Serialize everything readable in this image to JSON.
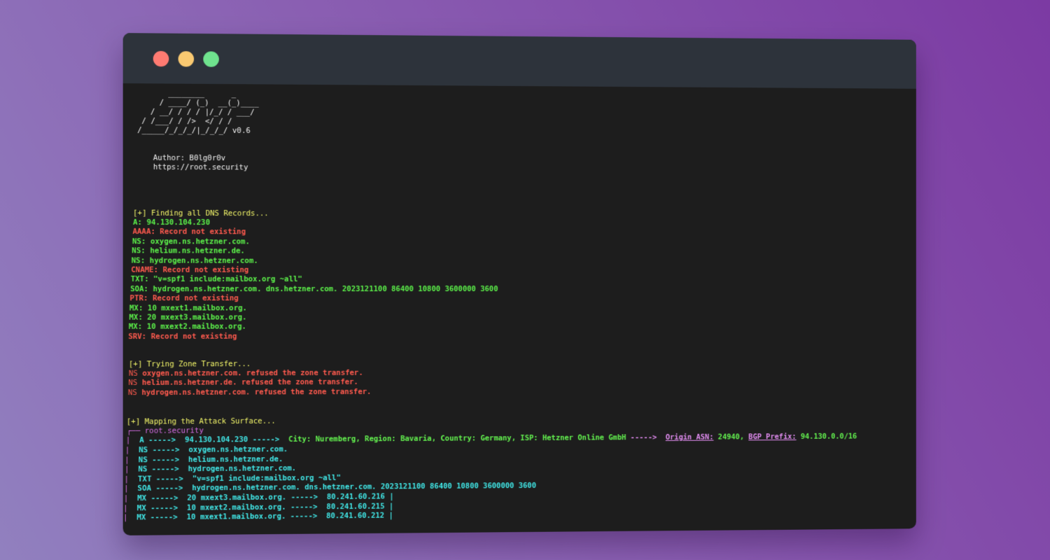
{
  "window": {
    "controls": [
      "close",
      "minimize",
      "maximize"
    ]
  },
  "banner": {
    "ascii": [
      "   ________      _",
      "  / ____/ (_)  __(_)____",
      " / __/ / / / |/_/ / ___/",
      "/ /___/ / />  </ / /",
      "/_____/_/_/_/|_/_/_/ v0.6"
    ],
    "author": "Author: B0lg0r0v",
    "url": "https://root.security"
  },
  "dns": {
    "header": "[+] Finding all DNS Records...",
    "records": [
      {
        "text": "A: 94.130.104.230",
        "status": "ok"
      },
      {
        "text": "AAAA: Record not existing",
        "status": "missing"
      },
      {
        "text": "NS: oxygen.ns.hetzner.com.",
        "status": "ok"
      },
      {
        "text": "NS: helium.ns.hetzner.de.",
        "status": "ok"
      },
      {
        "text": "NS: hydrogen.ns.hetzner.com.",
        "status": "ok"
      },
      {
        "text": "CNAME: Record not existing",
        "status": "missing"
      },
      {
        "text": "TXT: \"v=spf1 include:mailbox.org ~all\"",
        "status": "ok"
      },
      {
        "text": "SOA: hydrogen.ns.hetzner.com. dns.hetzner.com. 2023121100 86400 10800 3600000 3600",
        "status": "ok"
      },
      {
        "text": "PTR: Record not existing",
        "status": "missing"
      },
      {
        "text": "MX: 10 mxext1.mailbox.org.",
        "status": "ok"
      },
      {
        "text": "MX: 20 mxext3.mailbox.org.",
        "status": "ok"
      },
      {
        "text": "MX: 10 mxext2.mailbox.org.",
        "status": "ok"
      },
      {
        "text": "SRV: Record not existing",
        "status": "missing"
      }
    ]
  },
  "zone": {
    "header": "[+] Trying Zone Transfer...",
    "lines": [
      {
        "prefix": "NS",
        "text": " oxygen.ns.hetzner.com. refused the zone transfer."
      },
      {
        "prefix": "NS",
        "text": " helium.ns.hetzner.de. refused the zone transfer."
      },
      {
        "prefix": "NS",
        "text": " hydrogen.ns.hetzner.com. refused the zone transfer."
      }
    ]
  },
  "attack": {
    "header": "[+] Mapping the Attack Surface...",
    "root": "┌── root.security",
    "a_row": {
      "pipe": "|",
      "label": "  A ----->  94.130.104.230 ----->  ",
      "geo": "City: Nuremberg, Region: Bavaria, Country: Germany, ISP: Hetzner Online GmbH",
      "arrow": " ----->  ",
      "asn_label": "Origin ASN:",
      "asn_value": " 24940",
      "comma": ", ",
      "bgp_label": "BGP Prefix:",
      "bgp_value": " 94.130.0.0/16"
    },
    "rows": [
      "  NS ----->  oxygen.ns.hetzner.com.",
      "  NS ----->  helium.ns.hetzner.de.",
      "  NS ----->  hydrogen.ns.hetzner.com.",
      "  TXT ----->  \"v=spf1 include:mailbox.org ~all\"",
      "  SOA ----->  hydrogen.ns.hetzner.com. dns.hetzner.com. 2023121100 86400 10800 3600000 3600",
      "  MX ----->  20 mxext3.mailbox.org. ----->  80.241.60.216 |",
      "  MX ----->  10 mxext2.mailbox.org. ----->  80.241.60.215 |",
      "  MX ----->  10 mxext1.mailbox.org. ----->  80.241.60.212 |"
    ],
    "pipe": "|"
  }
}
